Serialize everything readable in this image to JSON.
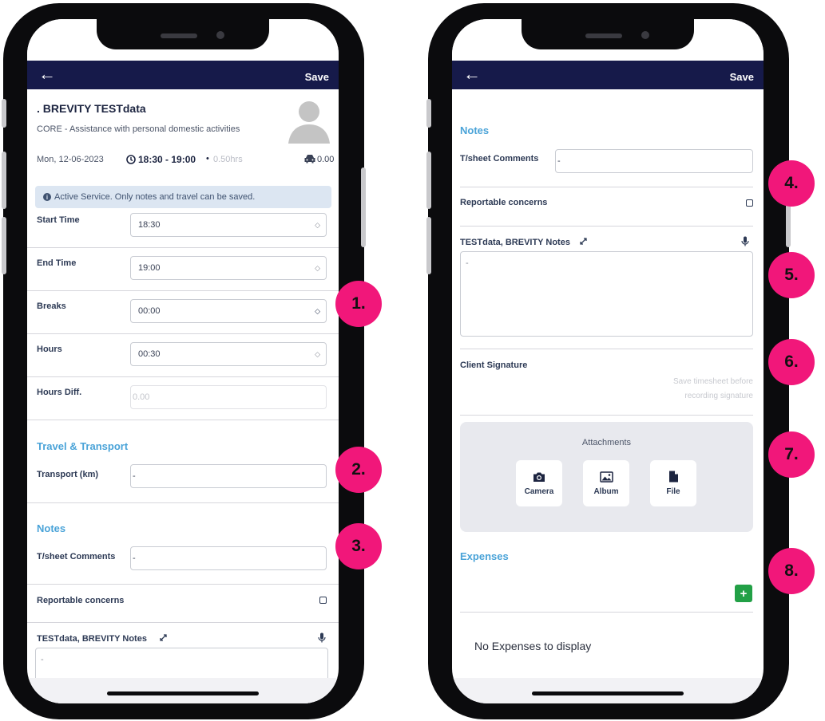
{
  "badges": [
    "1.",
    "2.",
    "3.",
    "4.",
    "5.",
    "6.",
    "7.",
    "8."
  ],
  "phone1": {
    "nav": {
      "back_icon": "←",
      "save": "Save"
    },
    "client_name": ". BREVITY TESTdata",
    "service": "CORE - Assistance with personal domestic activities",
    "date": "Mon, 12-06-2023",
    "time_range": "18:30 - 19:00",
    "hours_note": "0.50hrs",
    "travel_value": "0.00",
    "alert": "Active Service. Only notes and travel can be saved.",
    "fields": [
      {
        "label": "Start Time",
        "value": "18:30"
      },
      {
        "label": "End Time",
        "value": "19:00"
      },
      {
        "label": "Breaks",
        "value": "00:00"
      },
      {
        "label": "Hours",
        "value": "00:30"
      },
      {
        "label": "Hours Diff.",
        "value": "0.00"
      }
    ],
    "travel_section": "Travel & Transport",
    "transport_label": "Transport (km)",
    "transport_value": "-",
    "notes_section": "Notes",
    "comments_label": "T/sheet Comments",
    "comments_value": "-",
    "concerns_label": "Reportable concerns",
    "client_notes_label": "TESTdata, BREVITY Notes",
    "client_notes_value": "-"
  },
  "phone2": {
    "nav": {
      "back_icon": "←",
      "save": "Save"
    },
    "notes_section": "Notes",
    "comments_label": "T/sheet Comments",
    "comments_value": "-",
    "concerns_label": "Reportable concerns",
    "client_notes_label": "TESTdata, BREVITY Notes",
    "client_notes_value": "-",
    "signature_label": "Client Signature",
    "signature_hint_1": "Save timesheet before",
    "signature_hint_2": "recording signature",
    "attachments_title": "Attachments",
    "attach_buttons": [
      "Camera",
      "Album",
      "File"
    ],
    "expenses_section": "Expenses",
    "add_expense": "+",
    "no_expenses": "No Expenses to display"
  },
  "colors": {
    "navbar": "#161a4a",
    "section": "#4aa3d8",
    "badge": "#f1177a",
    "add_button": "#22a046"
  }
}
